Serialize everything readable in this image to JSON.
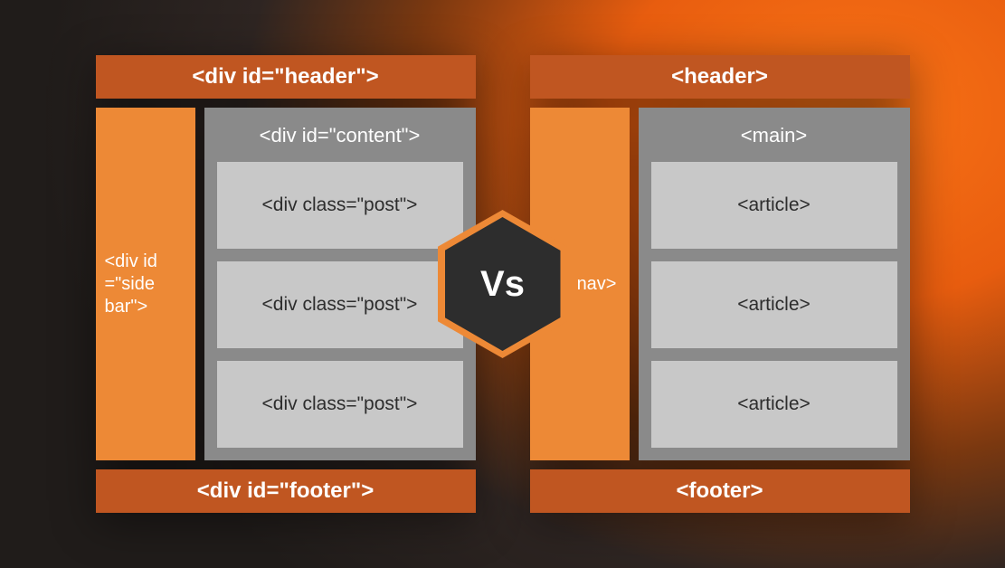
{
  "left": {
    "header": "<div id=\"header\">",
    "sidebar": "<div id =\"side bar\">",
    "content_title": "<div id=\"content\">",
    "posts": [
      "<div class=\"post\">",
      "<div class=\"post\">",
      "<div class=\"post\">"
    ],
    "footer": "<div id=\"footer\">"
  },
  "right": {
    "header": "<header>",
    "sidebar": "nav>",
    "content_title": "<main>",
    "posts": [
      "<article>",
      "<article>",
      "<article>"
    ],
    "footer": "<footer>"
  },
  "center": "Vs"
}
